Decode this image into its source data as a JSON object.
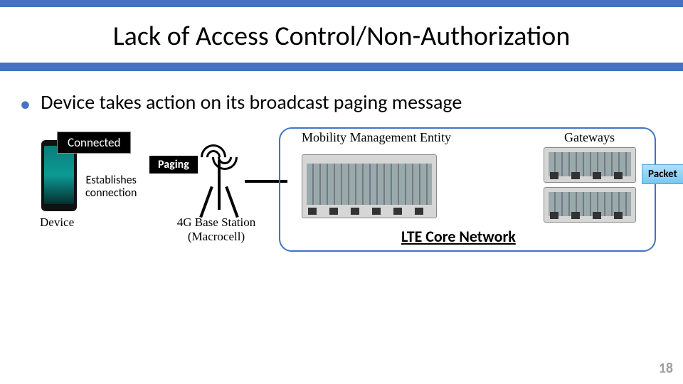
{
  "title": "Lack of Access Control/Non-Authorization",
  "bullet_text": "Device takes action on its broadcast paging message",
  "connected_label": "Connected",
  "device_label": "Device",
  "establishes_line1": "Establishes",
  "establishes_line2": "connection",
  "paging_label": "Paging",
  "bs_line1": "4G Base Station",
  "bs_line2": "(Macrocell)",
  "mme_label": "Mobility Management Entity",
  "gateways_label": "Gateways",
  "core_label": "LTE Core Network",
  "packet_label": "Packet",
  "page_number": "18"
}
